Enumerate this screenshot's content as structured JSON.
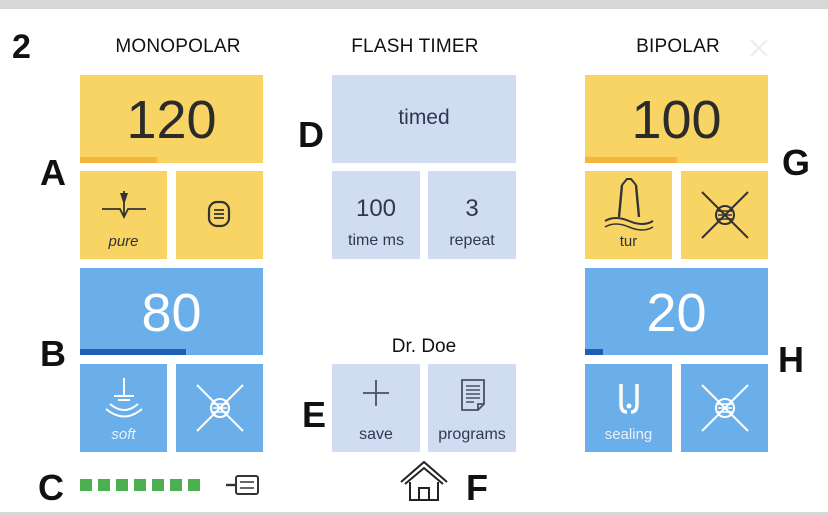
{
  "screen_number": "2",
  "callouts": {
    "a": "A",
    "b": "B",
    "c": "C",
    "d": "D",
    "e": "E",
    "f": "F",
    "g": "G",
    "h": "H"
  },
  "monopolar": {
    "title": "MONOPOLAR",
    "cut_value": "120",
    "cut_level": 0.42,
    "cut_mode_caption": "pure",
    "coag_value": "80",
    "coag_level": 0.58,
    "coag_mode_caption": "soft"
  },
  "flash_timer": {
    "title": "FLASH TIMER",
    "mode": "timed",
    "time_value": "100",
    "time_caption": "time ms",
    "repeat_value": "3",
    "repeat_caption": "repeat"
  },
  "bipolar": {
    "title": "BIPOLAR",
    "cut_value": "100",
    "cut_level": 0.5,
    "cut_mode_caption": "tur",
    "coag_value": "20",
    "coag_level": 0.1,
    "coag_mode_caption": "sealing"
  },
  "user": {
    "name": "Dr. Doe"
  },
  "actions": {
    "save_label": "save",
    "programs_label": "programs"
  },
  "footer": {
    "connection_segments": 7,
    "connection_color": "#4caf50"
  },
  "colors": {
    "yellow": "#f7d463",
    "blue": "#6aaeea",
    "lavender": "#cfdcf2",
    "bar_orange": "#f5b43c",
    "bar_blue": "#1d5fb5"
  },
  "icons": {
    "cut_mode": "pure-cut-waveform-icon",
    "monopolar_menu": "list-icon",
    "coag_mode": "soft-coag-electrode-icon",
    "disabled": "disabled-x-icon",
    "bipolar_cut_mode": "tur-loop-icon",
    "bipolar_coag_mode": "sealing-forceps-icon",
    "save": "plus-icon",
    "programs": "document-list-icon",
    "home": "home-icon",
    "plug": "connector-plug-icon",
    "close": "close-icon"
  }
}
